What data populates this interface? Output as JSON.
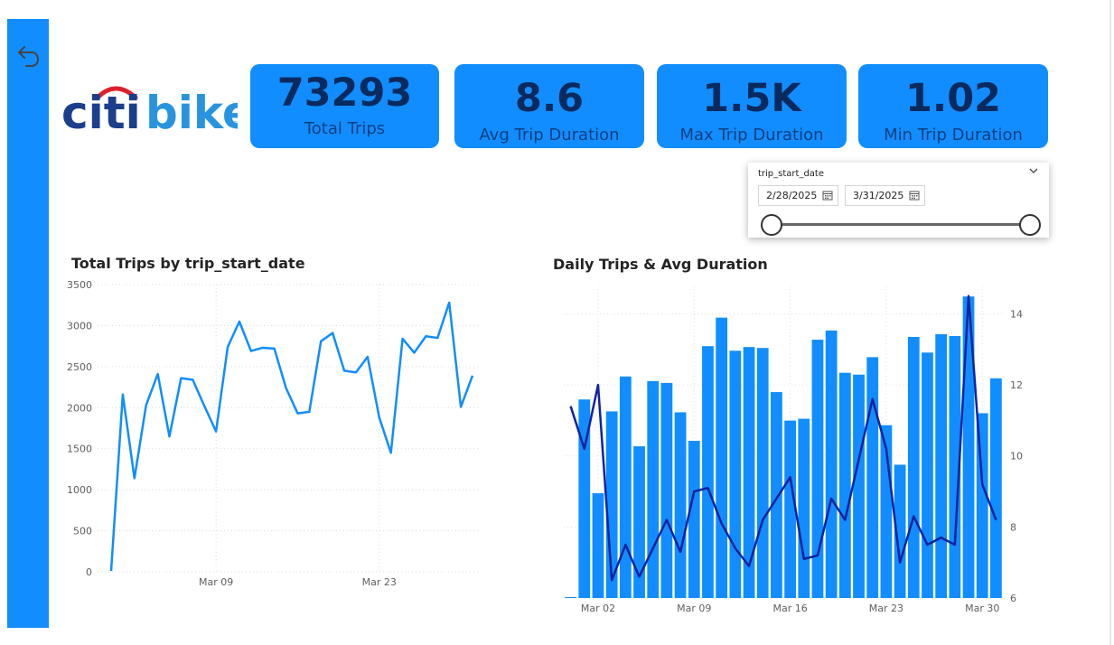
{
  "sidebar": {
    "back_icon": "back-arrow-icon"
  },
  "logo": {
    "text_citi": "citi",
    "text_bike": "bike",
    "reg": "®"
  },
  "cards": [
    {
      "value": "73293",
      "label": "Total Trips"
    },
    {
      "value": "8.6",
      "label": "Avg Trip Duration"
    },
    {
      "value": "1.5K",
      "label": "Max Trip Duration"
    },
    {
      "value": "1.02",
      "label": "Min Trip Duration"
    }
  ],
  "slicer": {
    "title": "trip_start_date",
    "start_date": "2/28/2025",
    "end_date": "3/31/2025",
    "calendar_icon": "calendar-icon",
    "chevron_icon": "chevron-down-icon"
  },
  "colors": {
    "accent": "#118dff",
    "dark_line": "#12239e",
    "card_text": "#0a2a5e"
  },
  "chart_data": [
    {
      "type": "line",
      "title": "Total Trips by trip_start_date",
      "y_ticks": [
        "3500",
        "3000",
        "2500",
        "2000",
        "1500",
        "1000",
        "500",
        "0"
      ],
      "x_tick_labels": [
        "Mar 09",
        "Mar 23"
      ],
      "ylim": [
        0,
        3500
      ],
      "grid": true,
      "series": [
        {
          "values": [
            10,
            2160,
            1140,
            2030,
            2410,
            1650,
            2360,
            2340,
            2020,
            1710,
            2740,
            3050,
            2690,
            2730,
            2720,
            2240,
            1930,
            1950,
            2810,
            2910,
            2450,
            2430,
            2620,
            1880,
            1450,
            2840,
            2670,
            2870,
            2850,
            3280,
            2010,
            2390
          ]
        }
      ]
    },
    {
      "type": "bar+line",
      "title": "Daily Trips & Avg Duration",
      "y2_ticks": [
        "14",
        "12",
        "10",
        "8",
        "6"
      ],
      "y2lim": [
        6,
        14.8
      ],
      "x_tick_labels": [
        "Mar 02",
        "Mar 09",
        "Mar 16",
        "Mar 23",
        "Mar 30"
      ],
      "grid": true,
      "bars": [
        10,
        2160,
        1140,
        2030,
        2410,
        1650,
        2360,
        2340,
        2020,
        1710,
        2740,
        3050,
        2690,
        2730,
        2720,
        2240,
        1930,
        1950,
        2810,
        2910,
        2450,
        2430,
        2620,
        1880,
        1450,
        2840,
        2670,
        2870,
        2850,
        3280,
        2010,
        2390
      ],
      "line": [
        11.4,
        10.2,
        12,
        6.5,
        7.5,
        6.6,
        7.4,
        8.2,
        7.3,
        9,
        9.1,
        8.1,
        7.4,
        6.9,
        8.2,
        8.8,
        9.4,
        7.1,
        7.2,
        8.8,
        8.2,
        9.9,
        11.6,
        10.2,
        7,
        8.3,
        7.5,
        7.7,
        7.5,
        14.5,
        9.2,
        8.2
      ]
    }
  ]
}
